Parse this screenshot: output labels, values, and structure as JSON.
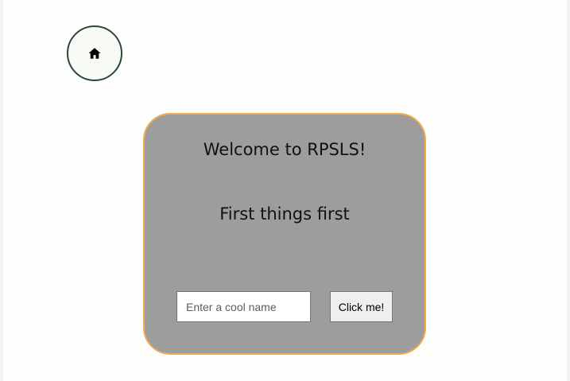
{
  "home": {
    "icon": "home-icon"
  },
  "card": {
    "title": "Welcome to RPSLS!",
    "subtitle": "First things first",
    "name_input": {
      "value": "",
      "placeholder": "Enter a cool name"
    },
    "submit_label": "Click me!"
  },
  "colors": {
    "page_background": "#fefefd",
    "card_background": "#9d9d9d",
    "card_border": "#f2ac4e",
    "home_border": "#2b4544",
    "home_background": "#f8fbf4"
  }
}
